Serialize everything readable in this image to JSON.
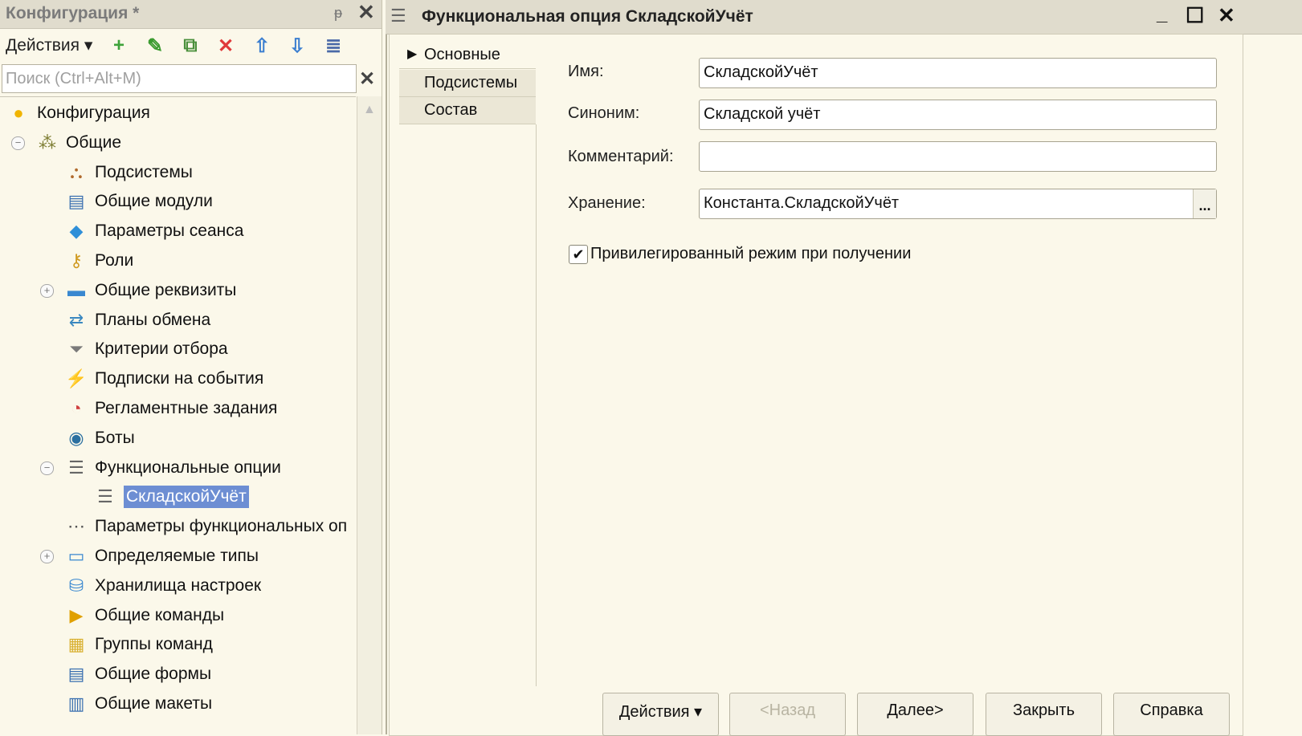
{
  "left": {
    "title": "Конфигурация *",
    "pin": "ᵽ",
    "close": "✕",
    "toolbar": {
      "actions_label": "Действия ▾",
      "icons": [
        {
          "name": "add-icon",
          "glyph": "+",
          "color": "#3ea33a"
        },
        {
          "name": "edit-icon",
          "glyph": "✎",
          "color": "#3a9a2e"
        },
        {
          "name": "copy-icon",
          "glyph": "⧉",
          "color": "#4a8f3b"
        },
        {
          "name": "delete-icon",
          "glyph": "✕",
          "color": "#e03a3a"
        },
        {
          "name": "move-up-icon",
          "glyph": "⇧",
          "color": "#3c7fd0"
        },
        {
          "name": "move-down-icon",
          "glyph": "⇩",
          "color": "#3c7fd0"
        },
        {
          "name": "sort-icon",
          "glyph": "≣",
          "color": "#4b6aa8"
        }
      ]
    },
    "search": {
      "placeholder": "Поиск (Ctrl+Alt+M)",
      "value": ""
    },
    "tree": [
      {
        "label": "Конфигурация",
        "icon": "configuration-icon",
        "glyph": "●",
        "color": "#f0b400",
        "level": 0
      },
      {
        "label": "Общие",
        "icon": "common-icon",
        "glyph": "⁂",
        "color": "#7a7a2e",
        "level": 1,
        "expander": "⊖"
      },
      {
        "label": "Подсистемы",
        "icon": "subsystems-icon",
        "glyph": "⛬",
        "color": "#b06a2c",
        "level": 2
      },
      {
        "label": "Общие модули",
        "icon": "common-modules-icon",
        "glyph": "▤",
        "color": "#3a6fb0",
        "level": 2
      },
      {
        "label": "Параметры сеанса",
        "icon": "session-parameters-icon",
        "glyph": "◆",
        "color": "#2f8fd8",
        "level": 2
      },
      {
        "label": "Роли",
        "icon": "roles-icon",
        "glyph": "⚷",
        "color": "#d09a20",
        "level": 2
      },
      {
        "label": "Общие реквизиты",
        "icon": "common-attributes-icon",
        "glyph": "▬",
        "color": "#3a88d0",
        "level": 2,
        "expander": "⊕"
      },
      {
        "label": "Планы обмена",
        "icon": "exchange-plans-icon",
        "glyph": "⇄",
        "color": "#3a88c0",
        "level": 2
      },
      {
        "label": "Критерии отбора",
        "icon": "filter-criteria-icon",
        "glyph": "⏷",
        "color": "#7a7a7a",
        "level": 2
      },
      {
        "label": "Подписки на события",
        "icon": "event-subscriptions-icon",
        "glyph": "⚡",
        "color": "#e0a000",
        "level": 2
      },
      {
        "label": "Регламентные задания",
        "icon": "scheduled-jobs-icon",
        "glyph": "◔",
        "color": "#d04040",
        "level": 2
      },
      {
        "label": "Боты",
        "icon": "bots-icon",
        "glyph": "◉",
        "color": "#2a6fa0",
        "level": 2
      },
      {
        "label": "Функциональные опции",
        "icon": "functional-options-icon",
        "glyph": "☰",
        "color": "#666",
        "level": 2,
        "expander": "⊖"
      },
      {
        "label": "СкладскойУчёт",
        "icon": "functional-option-item-icon",
        "glyph": "☰",
        "color": "#666",
        "level": 3,
        "selected": true
      },
      {
        "label": "Параметры функциональных оп",
        "icon": "functional-option-parameters-icon",
        "glyph": "⋯",
        "color": "#555",
        "level": 2
      },
      {
        "label": "Определяемые типы",
        "icon": "defined-types-icon",
        "glyph": "▭",
        "color": "#3a88d0",
        "level": 2,
        "expander": "⊕"
      },
      {
        "label": "Хранилища настроек",
        "icon": "settings-storages-icon",
        "glyph": "⛁",
        "color": "#3a88d0",
        "level": 2
      },
      {
        "label": "Общие команды",
        "icon": "common-commands-icon",
        "glyph": "▶",
        "color": "#e0a000",
        "level": 2
      },
      {
        "label": "Группы команд",
        "icon": "command-groups-icon",
        "glyph": "▦",
        "color": "#d9b030",
        "level": 2
      },
      {
        "label": "Общие формы",
        "icon": "common-forms-icon",
        "glyph": "▤",
        "color": "#3a6fb0",
        "level": 2
      },
      {
        "label": "Общие макеты",
        "icon": "common-templates-icon",
        "glyph": "▥",
        "color": "#3a6fb0",
        "level": 2
      }
    ]
  },
  "right": {
    "title": "Функциональная опция СкладскойУчёт",
    "window_buttons": {
      "minimize": "_",
      "maximize": "☐",
      "close": "✕"
    },
    "tabs": [
      {
        "label": "Основные",
        "active": true
      },
      {
        "label": "Подсистемы"
      },
      {
        "label": "Состав"
      }
    ],
    "form": {
      "name_label": "Имя:",
      "name_value": "СкладскойУчёт",
      "synonym_label": "Синоним:",
      "synonym_value": "Складской учёт",
      "comment_label": "Комментарий:",
      "comment_value": "",
      "storage_label": "Хранение:",
      "storage_value": "Константа.СкладскойУчёт",
      "storage_button": "...",
      "privileged_label": "Привилегированный режим при получении",
      "privileged_checked": true
    },
    "buttons": [
      "Действия ▾",
      "<Назад",
      "Далее>",
      "Закрыть",
      "Справка"
    ]
  }
}
